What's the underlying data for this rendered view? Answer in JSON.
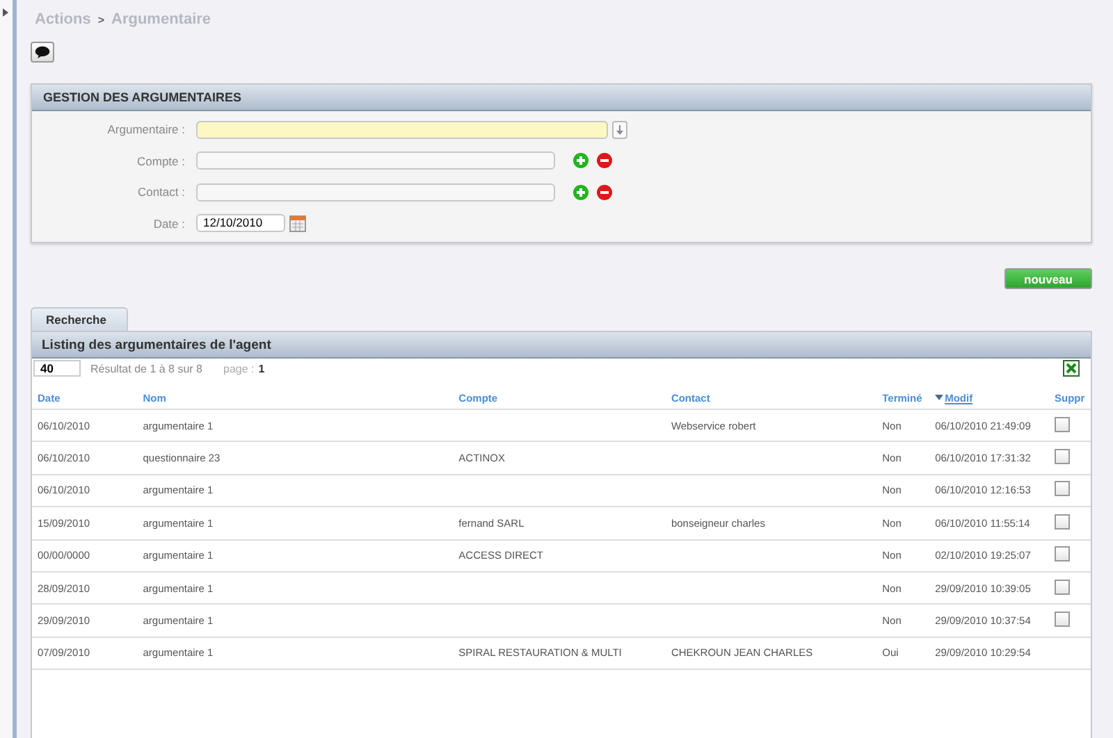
{
  "breadcrumb": {
    "section": "Actions",
    "separator": ">",
    "page": "Argumentaire"
  },
  "form": {
    "title": "GESTION DES ARGUMENTAIRES",
    "fields": [
      {
        "kind": "select",
        "label": "Argumentaire :"
      },
      {
        "kind": "lookup",
        "label": "Compte :"
      },
      {
        "kind": "lookup",
        "label": "Contact :"
      },
      {
        "kind": "date",
        "label": "Date :",
        "value": "12/10/2010"
      }
    ]
  },
  "new_button": "nouveau",
  "tabs": [
    {
      "label": "Recherche",
      "selected": true
    }
  ],
  "listing": {
    "title": "Listing des argumentaires de l'agent",
    "page_size": "40",
    "result_text": "Résultat de 1 à 8 sur 8",
    "page_label": "page :",
    "page": "1",
    "columns": [
      {
        "label": "Date",
        "sorted": false
      },
      {
        "label": "Nom",
        "sorted": false
      },
      {
        "label": "Compte",
        "sorted": false
      },
      {
        "label": "Contact",
        "sorted": false
      },
      {
        "label": "Terminé",
        "sorted": false
      },
      {
        "label": "Modif",
        "sorted": true
      },
      {
        "label": "Suppr",
        "sorted": false
      }
    ],
    "rows": [
      {
        "date": "06/10/2010",
        "nom": "argumentaire 1",
        "contact": "Webservice robert",
        "termine": "Non",
        "modif": "06/10/2010 21:49:09",
        "deletable": true
      },
      {
        "date": "06/10/2010",
        "nom": "questionnaire 23",
        "compte": "ACTINOX",
        "termine": "Non",
        "modif": "06/10/2010 17:31:32",
        "deletable": true
      },
      {
        "date": "06/10/2010",
        "nom": "argumentaire 1",
        "termine": "Non",
        "modif": "06/10/2010 12:16:53",
        "deletable": true
      },
      {
        "date": "15/09/2010",
        "nom": "argumentaire 1",
        "compte": "fernand SARL",
        "contact": "bonseigneur charles",
        "termine": "Non",
        "modif": "06/10/2010 11:55:14",
        "deletable": true
      },
      {
        "date": "00/00/0000",
        "nom": "argumentaire 1",
        "compte": "ACCESS DIRECT",
        "termine": "Non",
        "modif": "02/10/2010 19:25:07",
        "deletable": true
      },
      {
        "date": "28/09/2010",
        "nom": "argumentaire 1",
        "termine": "Non",
        "modif": "29/09/2010 10:39:05",
        "deletable": true
      },
      {
        "date": "29/09/2010",
        "nom": "argumentaire 1",
        "termine": "Non",
        "modif": "29/09/2010 10:37:54",
        "deletable": true
      },
      {
        "date": "07/09/2010",
        "nom": "argumentaire 1",
        "compte": "SPIRAL RESTAURATION & MULTI",
        "contact": "CHEKROUN JEAN CHARLES",
        "termine": "Oui",
        "modif": "29/09/2010 10:29:54",
        "deletable": false
      }
    ]
  }
}
